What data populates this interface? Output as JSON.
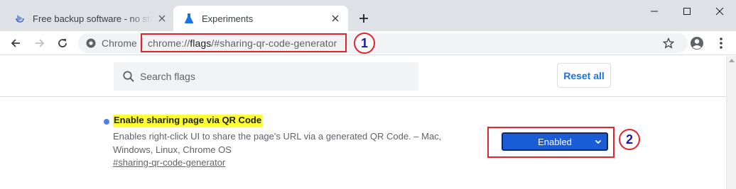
{
  "tabs": [
    {
      "title": "Free backup software - no strings attached",
      "active": false,
      "favicon": "backup-app-icon"
    },
    {
      "title": "Experiments",
      "active": true,
      "favicon": "flask-icon"
    }
  ],
  "window_controls": [
    "minimize-icon",
    "maximize-icon",
    "close-icon"
  ],
  "toolbar": {
    "scheme_label": "Chrome",
    "url_prefix": "chrome://",
    "url_host": "flags",
    "url_rest": "/#sharing-qr-code-generator"
  },
  "page": {
    "search_placeholder": "Search flags",
    "reset_label": "Reset all"
  },
  "flag": {
    "title": "Enable sharing page via QR Code",
    "description": "Enables right-click UI to share the page's URL via a generated QR Code. – Mac, Windows, Linux, Chrome OS",
    "link": "#sharing-qr-code-generator",
    "selected_value": "Enabled"
  },
  "annotations": {
    "badge_1": "1",
    "badge_2": "2"
  },
  "colors": {
    "accent": "#1a73e8",
    "highlight": "#ffff33",
    "annotation_red": "#e0242d",
    "select_fill": "#1a5bd6"
  }
}
